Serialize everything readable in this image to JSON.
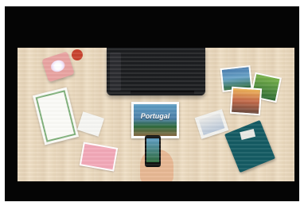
{
  "photo": {
    "description_free": true,
    "printed_photo": {
      "text": "Portugal"
    }
  }
}
